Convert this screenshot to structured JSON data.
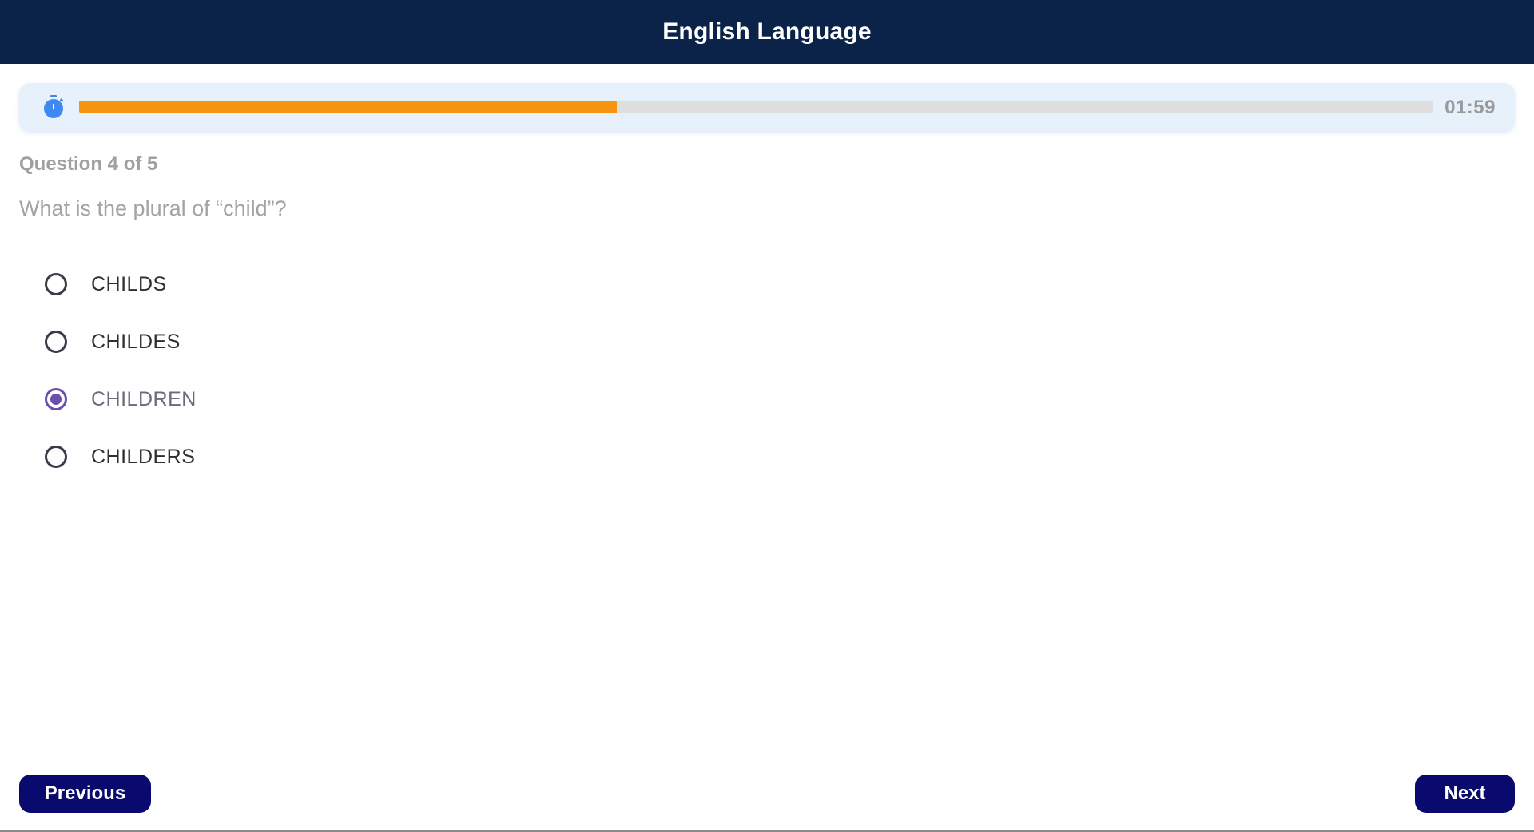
{
  "header": {
    "title": "English Language"
  },
  "timer": {
    "remaining": "01:59",
    "progress_fraction": 0.397,
    "fill_color": "#f7940f",
    "icon": "stopwatch-icon"
  },
  "question": {
    "counter": "Question 4 of 5",
    "text": "What is the plural of “child”?",
    "options": [
      {
        "label": "CHILDS",
        "selected": false
      },
      {
        "label": "CHILDES",
        "selected": false
      },
      {
        "label": "CHILDREN",
        "selected": true
      },
      {
        "label": "CHILDERS",
        "selected": false
      }
    ]
  },
  "navigation": {
    "previous_label": "Previous",
    "next_label": "Next"
  },
  "colors": {
    "header_bg": "#0b2348",
    "button_bg": "#0a0a6e",
    "selected_radio": "#6b4fa8",
    "icon_blue": "#3f88f2"
  }
}
